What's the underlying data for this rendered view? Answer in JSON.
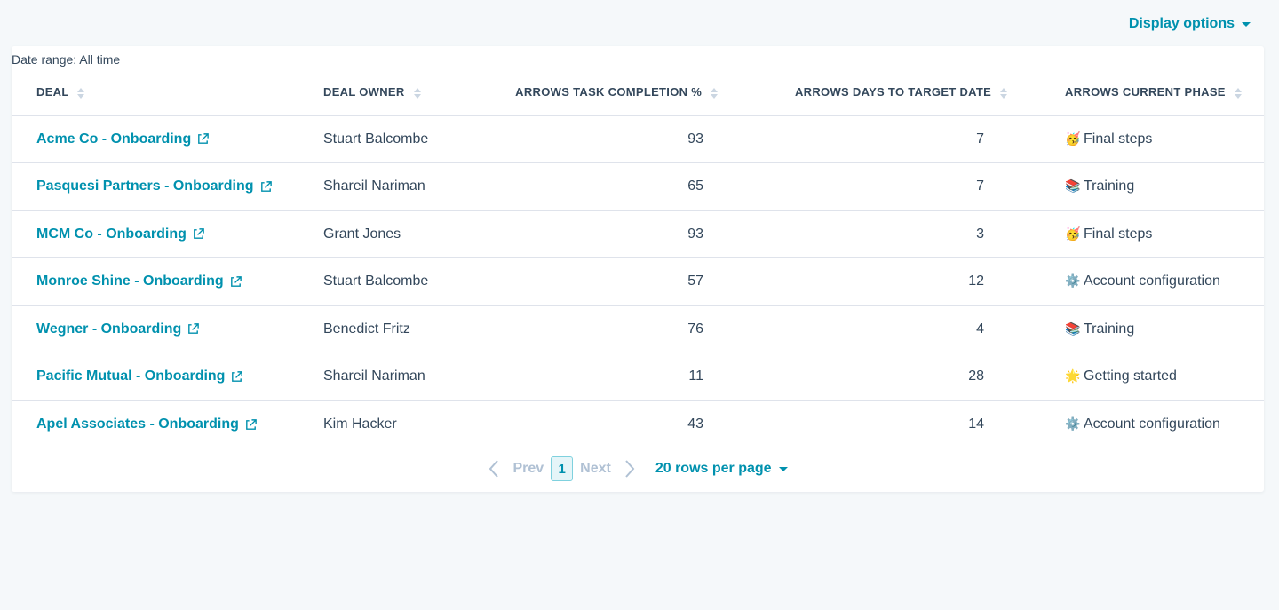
{
  "header": {
    "display_options_label": "Display options"
  },
  "report": {
    "date_range": "Date range: All time",
    "columns": {
      "deal": "DEAL",
      "owner": "DEAL OWNER",
      "task": "ARROWS TASK COMPLETION %",
      "days": "ARROWS DAYS TO TARGET DATE",
      "phase": "ARROWS CURRENT PHASE"
    },
    "rows": [
      {
        "deal": "Acme Co - Onboarding",
        "owner": "Stuart Balcombe",
        "task": "93",
        "days": "7",
        "phase_emoji": "🥳",
        "phase": "Final steps"
      },
      {
        "deal": "Pasquesi Partners - Onboarding",
        "owner": "Shareil Nariman",
        "task": "65",
        "days": "7",
        "phase_emoji": "📚",
        "phase": "Training"
      },
      {
        "deal": "MCM Co - Onboarding",
        "owner": "Grant Jones",
        "task": "93",
        "days": "3",
        "phase_emoji": "🥳",
        "phase": "Final steps"
      },
      {
        "deal": "Monroe Shine - Onboarding",
        "owner": "Stuart Balcombe",
        "task": "57",
        "days": "12",
        "phase_emoji": "⚙️",
        "phase": "Account configuration"
      },
      {
        "deal": "Wegner - Onboarding",
        "owner": "Benedict Fritz",
        "task": "76",
        "days": "4",
        "phase_emoji": "📚",
        "phase": "Training"
      },
      {
        "deal": "Pacific Mutual - Onboarding",
        "owner": "Shareil Nariman",
        "task": "11",
        "days": "28",
        "phase_emoji": "🌟",
        "phase": "Getting started"
      },
      {
        "deal": "Apel Associates - Onboarding",
        "owner": "Kim Hacker",
        "task": "43",
        "days": "14",
        "phase_emoji": "⚙️",
        "phase": "Account configuration"
      }
    ]
  },
  "pagination": {
    "prev_label": "Prev",
    "current_page": "1",
    "next_label": "Next",
    "rows_per_page_label": "20 rows per page"
  },
  "colors": {
    "accent": "#0091ae",
    "text": "#33475b",
    "background": "#f5f8fa"
  }
}
